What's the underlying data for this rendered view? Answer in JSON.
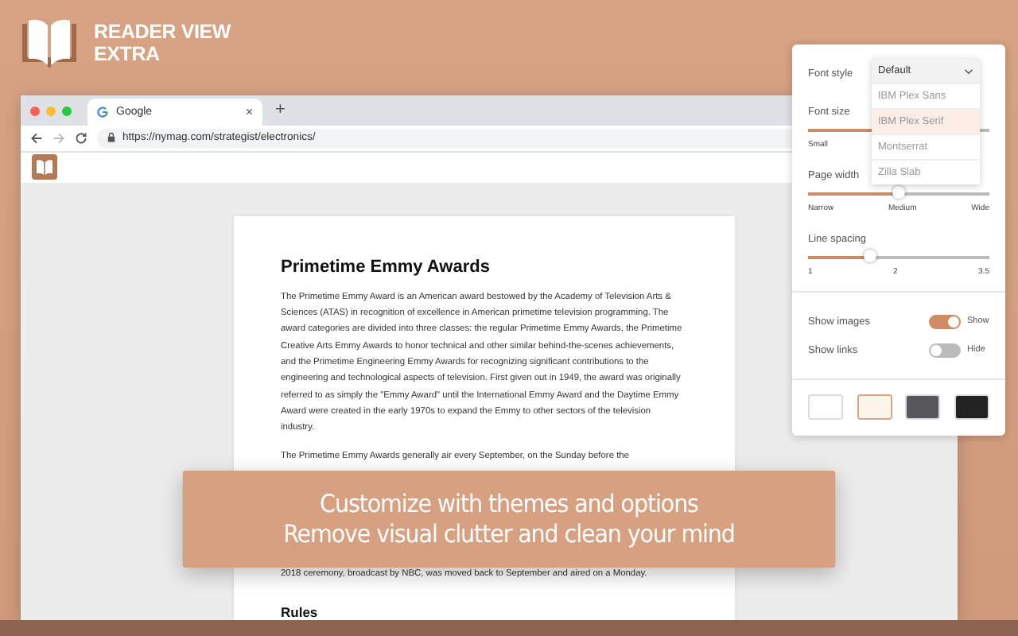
{
  "brand": {
    "title_line_1": "READER VIEW",
    "title_line_2": "EXTRA"
  },
  "browser": {
    "tab": {
      "title": "Google",
      "close": "×"
    },
    "new_tab": "+",
    "url": "https://nymag.com/strategist/electronics/"
  },
  "article": {
    "title": "Primetime Emmy Awards",
    "paragraph_1": "The Primetime Emmy Award is an American award bestowed by the Academy of Television Arts & Sciences (ATAS) in recognition of excellence in American primetime television programming. The award categories are divided into three classes: the regular Primetime Emmy Awards, the Primetime Creative Arts Emmy Awards to honor technical and other similar behind-the-scenes achievements, and the Primetime Engineering Emmy Awards for recognizing significant contributions to the engineering and technological aspects of television. First given out in 1949, the award was originally referred to as simply the \"Emmy Award\" until the International Emmy Award and the Daytime Emmy Award were created in the early 1970s to expand the Emmy to other sectors of the television industry.",
    "paragraph_2_start": "The Primetime Emmy Awards generally air every September, on the Sunday before the",
    "paragraph_2_end": "2018 ceremony, broadcast by NBC, was moved back to September and aired on a Monday.",
    "heading_2": "Rules"
  },
  "popup": {
    "font_style": {
      "label": "Font style",
      "value": "Default",
      "options": [
        {
          "label": "IBM Plex Sans",
          "selected": false
        },
        {
          "label": "IBM Plex Serif",
          "selected": true
        },
        {
          "label": "Montserrat",
          "selected": false
        },
        {
          "label": "Zilla Slab",
          "selected": false
        }
      ]
    },
    "sliders": [
      {
        "label": "Font size",
        "level": 0.5,
        "ticks": [
          "Small"
        ]
      },
      {
        "label": "Page width",
        "level": 0.5,
        "ticks": [
          "Narrow",
          "Medium",
          "Wide"
        ]
      },
      {
        "label": "Line spacing",
        "level": 0.34,
        "ticks": [
          "1",
          "2",
          "3.5"
        ]
      }
    ],
    "toggles": [
      {
        "label": "Show images",
        "on": true,
        "state_text": "Show"
      },
      {
        "label": "Show links",
        "on": false,
        "state_text": "Hide"
      }
    ],
    "themes": [
      {
        "color": "#ffffff",
        "selected": false
      },
      {
        "color": "#fcf5ea",
        "selected": true
      },
      {
        "color": "#58585c",
        "selected": false
      },
      {
        "color": "#222222",
        "selected": false
      }
    ]
  },
  "banner": {
    "line_1": "Customize with themes and options",
    "line_2": "Remove visual clutter and clean your mind"
  }
}
